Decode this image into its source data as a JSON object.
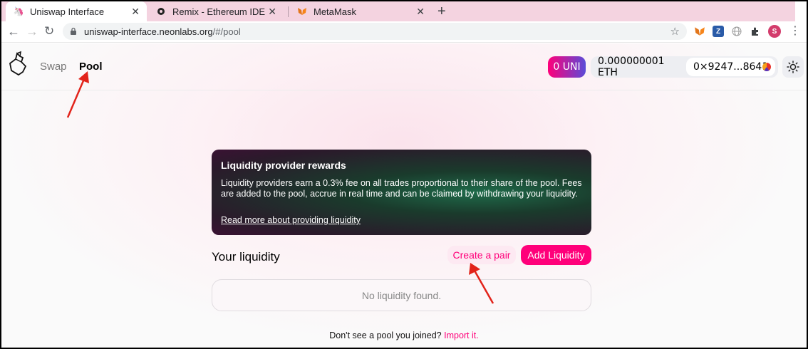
{
  "browser": {
    "tabs": [
      {
        "title": "Uniswap Interface",
        "icon": "unicorn-icon",
        "active": true
      },
      {
        "title": "Remix - Ethereum IDE",
        "icon": "remix-icon",
        "active": false
      },
      {
        "title": "MetaMask",
        "icon": "metamask-fox-icon",
        "active": false
      }
    ],
    "close_glyph": "✕",
    "new_tab_glyph": "+",
    "url_host": "uniswap-interface.neonlabs.org",
    "url_path": "/#/pool",
    "profile_initial": "S",
    "ext_z_label": "Z"
  },
  "nav": {
    "swap": "Swap",
    "pool": "Pool"
  },
  "account": {
    "uni_balance": "0 UNI",
    "eth_balance": "0.000000001 ETH",
    "address": "0×9247...8641"
  },
  "rewards": {
    "title": "Liquidity provider rewards",
    "body": "Liquidity providers earn a 0.3% fee on all trades proportional to their share of the pool. Fees are added to the pool, accrue in real time and can be claimed by withdrawing your liquidity.",
    "link": "Read more about providing liquidity"
  },
  "liquidity": {
    "heading": "Your liquidity",
    "create_pair": "Create a pair",
    "add_liquidity": "Add Liquidity",
    "empty": "No liquidity found."
  },
  "import": {
    "prompt": "Don't see a pool you joined?",
    "link": "Import it."
  },
  "colors": {
    "accent": "#ff007a",
    "annotation": "#e2231a"
  }
}
